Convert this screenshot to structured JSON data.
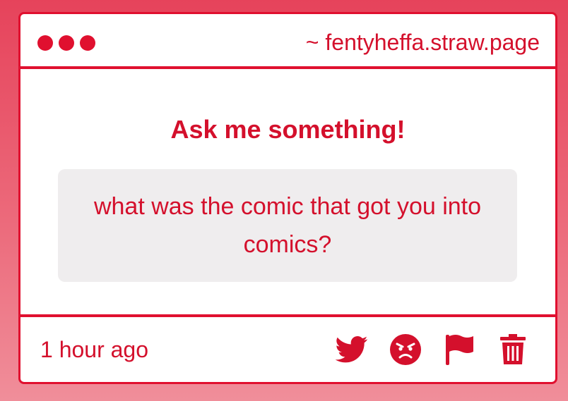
{
  "window": {
    "url_text": "~ fentyheffa.straw.page"
  },
  "main": {
    "heading": "Ask me something!",
    "question": "what was the comic that got you into comics?"
  },
  "footer": {
    "timestamp": "1 hour ago",
    "actions": [
      {
        "icon": "twitter-icon"
      },
      {
        "icon": "angry-face-icon"
      },
      {
        "icon": "flag-icon"
      },
      {
        "icon": "trash-icon"
      }
    ]
  },
  "colors": {
    "accent": "#e0102f",
    "question_bg": "#efedee",
    "page_bg_top": "#e6435b",
    "page_bg_bottom": "#f08e9a"
  }
}
